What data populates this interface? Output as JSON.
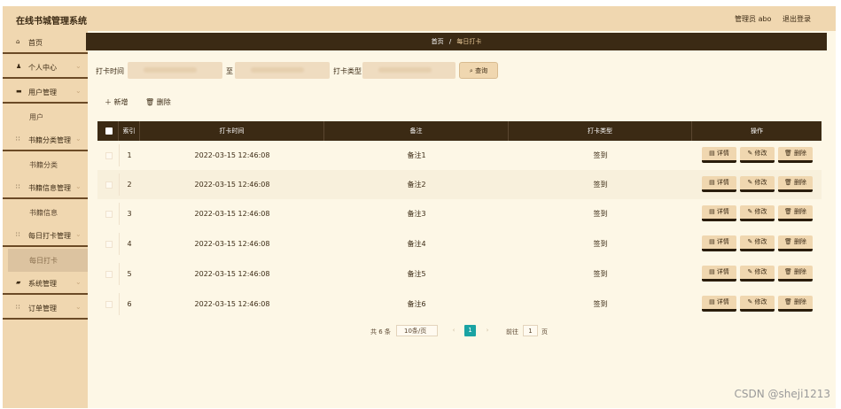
{
  "header": {
    "app_title": "在线书城管理系统",
    "admin_label": "管理员 abo",
    "logout_label": "退出登录"
  },
  "sidebar": {
    "items": [
      {
        "icon": "home-icon",
        "glyph": "⌂",
        "label": "首页"
      },
      {
        "icon": "user-icon",
        "glyph": "♟",
        "label": "个人中心"
      },
      {
        "icon": "list-icon",
        "glyph": "▬",
        "label": "用户管理"
      },
      {
        "icon": "grid-icon",
        "glyph": "∷",
        "label": "书籍分类管理"
      },
      {
        "icon": "grid-icon",
        "glyph": "∷",
        "label": "书籍信息管理"
      },
      {
        "icon": "grid-icon",
        "glyph": "∷",
        "label": "每日打卡管理"
      },
      {
        "icon": "book-icon",
        "glyph": "▰",
        "label": "系统管理"
      },
      {
        "icon": "grid-icon",
        "glyph": "∷",
        "label": "订单管理"
      }
    ],
    "sub_items": {
      "users": "用户",
      "category": "书籍分类",
      "books": "书籍信息",
      "checkin": "每日打卡"
    }
  },
  "breadcrumb": {
    "home": "首页",
    "sep": "/",
    "current": "每日打卡"
  },
  "search": {
    "time_label": "打卡时间",
    "to_label": "至",
    "type_label": "打卡类型",
    "query_label": "⌕ 查询"
  },
  "actions": {
    "add_label": "＋ 新增",
    "delete_label": "🗑 删除"
  },
  "table": {
    "columns": [
      "索引",
      "打卡时间",
      "备注",
      "打卡类型",
      "操作"
    ],
    "rows": [
      {
        "index": "1",
        "time": "2022-03-15 12:46:08",
        "note": "备注1",
        "type": "签到"
      },
      {
        "index": "2",
        "time": "2022-03-15 12:46:08",
        "note": "备注2",
        "type": "签到"
      },
      {
        "index": "3",
        "time": "2022-03-15 12:46:08",
        "note": "备注3",
        "type": "签到"
      },
      {
        "index": "4",
        "time": "2022-03-15 12:46:08",
        "note": "备注4",
        "type": "签到"
      },
      {
        "index": "5",
        "time": "2022-03-15 12:46:08",
        "note": "备注5",
        "type": "签到"
      },
      {
        "index": "6",
        "time": "2022-03-15 12:46:08",
        "note": "备注6",
        "type": "签到"
      }
    ],
    "ops": {
      "detail": "▤ 详情",
      "edit": "✎ 修改",
      "delete": "🗑 删除"
    }
  },
  "pager": {
    "total": "共 6 条",
    "page_size": "10条/页",
    "prev": "‹",
    "current": "1",
    "next": "›",
    "goto_label": "前往",
    "goto_value": "1",
    "page_unit": "页"
  },
  "watermark": "CSDN @sheji1213",
  "colors": {
    "accent_dark": "#3b2a14",
    "accent_light": "#f0d7b0",
    "page_active": "#1aa3a3"
  }
}
